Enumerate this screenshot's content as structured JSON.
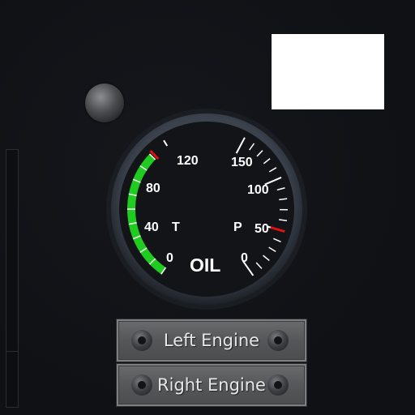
{
  "gauge": {
    "title": "OIL",
    "temp_letter": "T",
    "pressure_letter": "P",
    "temp_ticks": [
      "120",
      "80",
      "40",
      "0"
    ],
    "pressure_ticks": [
      "150",
      "100",
      "50",
      "0"
    ],
    "temp_value_fraction": 0.9,
    "colors": {
      "green_band": "#1fcc1f",
      "red_mark": "#e01010",
      "tick": "#ffffff",
      "face": "#111316",
      "bezel": "#3f4652"
    }
  },
  "buttons": {
    "left_engine": "Left Engine",
    "right_engine": "Right Engine"
  }
}
